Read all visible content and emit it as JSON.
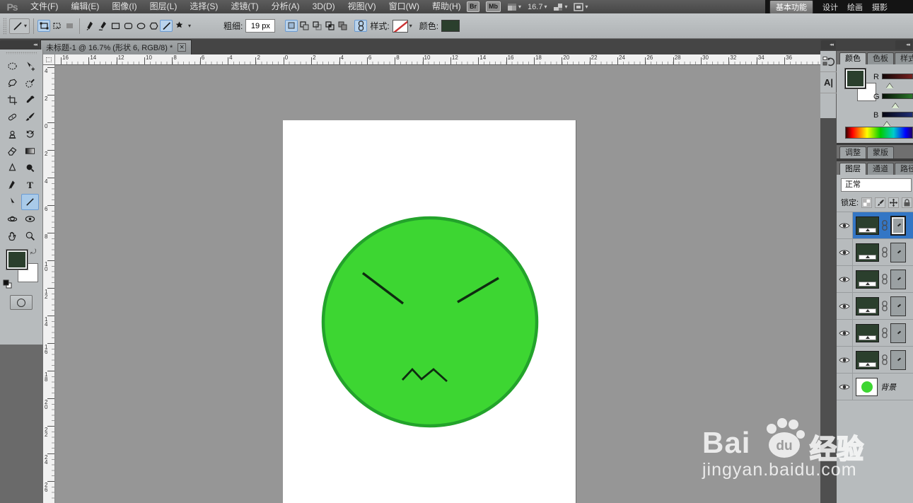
{
  "menu_bar": {
    "logo": "Ps",
    "items": [
      "文件(F)",
      "编辑(E)",
      "图像(I)",
      "图层(L)",
      "选择(S)",
      "滤镜(T)",
      "分析(A)",
      "3D(D)",
      "视图(V)",
      "窗口(W)",
      "帮助(H)"
    ],
    "bridge_button": "Br",
    "mobile_button": "Mb",
    "zoom_level": "16.7",
    "workspaces": [
      "基本功能",
      "设计",
      "绘画",
      "摄影"
    ],
    "active_workspace": "基本功能"
  },
  "options_bar": {
    "weight_label": "粗细:",
    "weight_value": "19 px",
    "style_label": "样式:",
    "color_label": "颜色:",
    "color_value": "#2b3f2d"
  },
  "document_tab": {
    "title": "未标题-1 @ 16.7% (形状 6, RGB/8) *"
  },
  "icons": {
    "close": "×",
    "dropdown": "▾",
    "collapse": "◂◂",
    "swap": "⤾"
  },
  "rulers": {
    "horizontal": [
      "16",
      "14",
      "12",
      "10",
      "8",
      "6",
      "4",
      "2",
      "0",
      "2",
      "4",
      "6",
      "8",
      "10",
      "12",
      "14",
      "16",
      "18",
      "20",
      "22",
      "24",
      "26",
      "28",
      "30",
      "32",
      "34",
      "36"
    ],
    "vertical": [
      "4",
      "2",
      "0",
      "2",
      "4",
      "6",
      "8",
      "10",
      "12",
      "14",
      "16",
      "18",
      "20",
      "22",
      "24",
      "26"
    ]
  },
  "tool_panel": {
    "tools": [
      "elliptical-marquee",
      "move",
      "polygon-lasso",
      "quick-selection",
      "crop",
      "eyedropper",
      "spot-healing-brush",
      "brush",
      "clone-stamp",
      "history-brush",
      "eraser",
      "gradient",
      "blur",
      "dodge",
      "pen",
      "type",
      "path-selection",
      "line",
      "3d-rotate",
      "3d-orbit",
      "hand",
      "zoom"
    ],
    "active_tool": "line",
    "foreground_color": "#2b3f2d",
    "background_color": "#ffffff"
  },
  "color_panel": {
    "tabs": [
      "颜色",
      "色板",
      "样式"
    ],
    "active_tab": "颜色",
    "channels": [
      "R",
      "G",
      "B"
    ],
    "foreground_color": "#2b3f2d",
    "background_color": "#ffffff"
  },
  "adjustments_panel": {
    "tabs": [
      "调整",
      "蒙版"
    ]
  },
  "layers_panel": {
    "tabs": [
      "图层",
      "通道",
      "路径"
    ],
    "active_tab": "图层",
    "blend_mode": "正常",
    "lock_label": "锁定:",
    "selection_color": "#3376c5",
    "shape_thumb_color": "#2b3f2d",
    "layers": [
      {
        "type": "shape",
        "selected": true
      },
      {
        "type": "shape",
        "selected": false
      },
      {
        "type": "shape",
        "selected": false
      },
      {
        "type": "shape",
        "selected": false
      },
      {
        "type": "shape",
        "selected": false
      },
      {
        "type": "shape",
        "selected": false
      },
      {
        "type": "background",
        "label": "背景",
        "selected": false
      }
    ]
  },
  "canvas": {
    "face": {
      "fill": "#3dd632",
      "stroke": "#23a32b",
      "features": "#0e2c10"
    }
  },
  "watermark": {
    "brand_bai": "Bai",
    "brand_du": "du",
    "brand_jingyan": "经验",
    "url": "jingyan.baidu.com"
  }
}
